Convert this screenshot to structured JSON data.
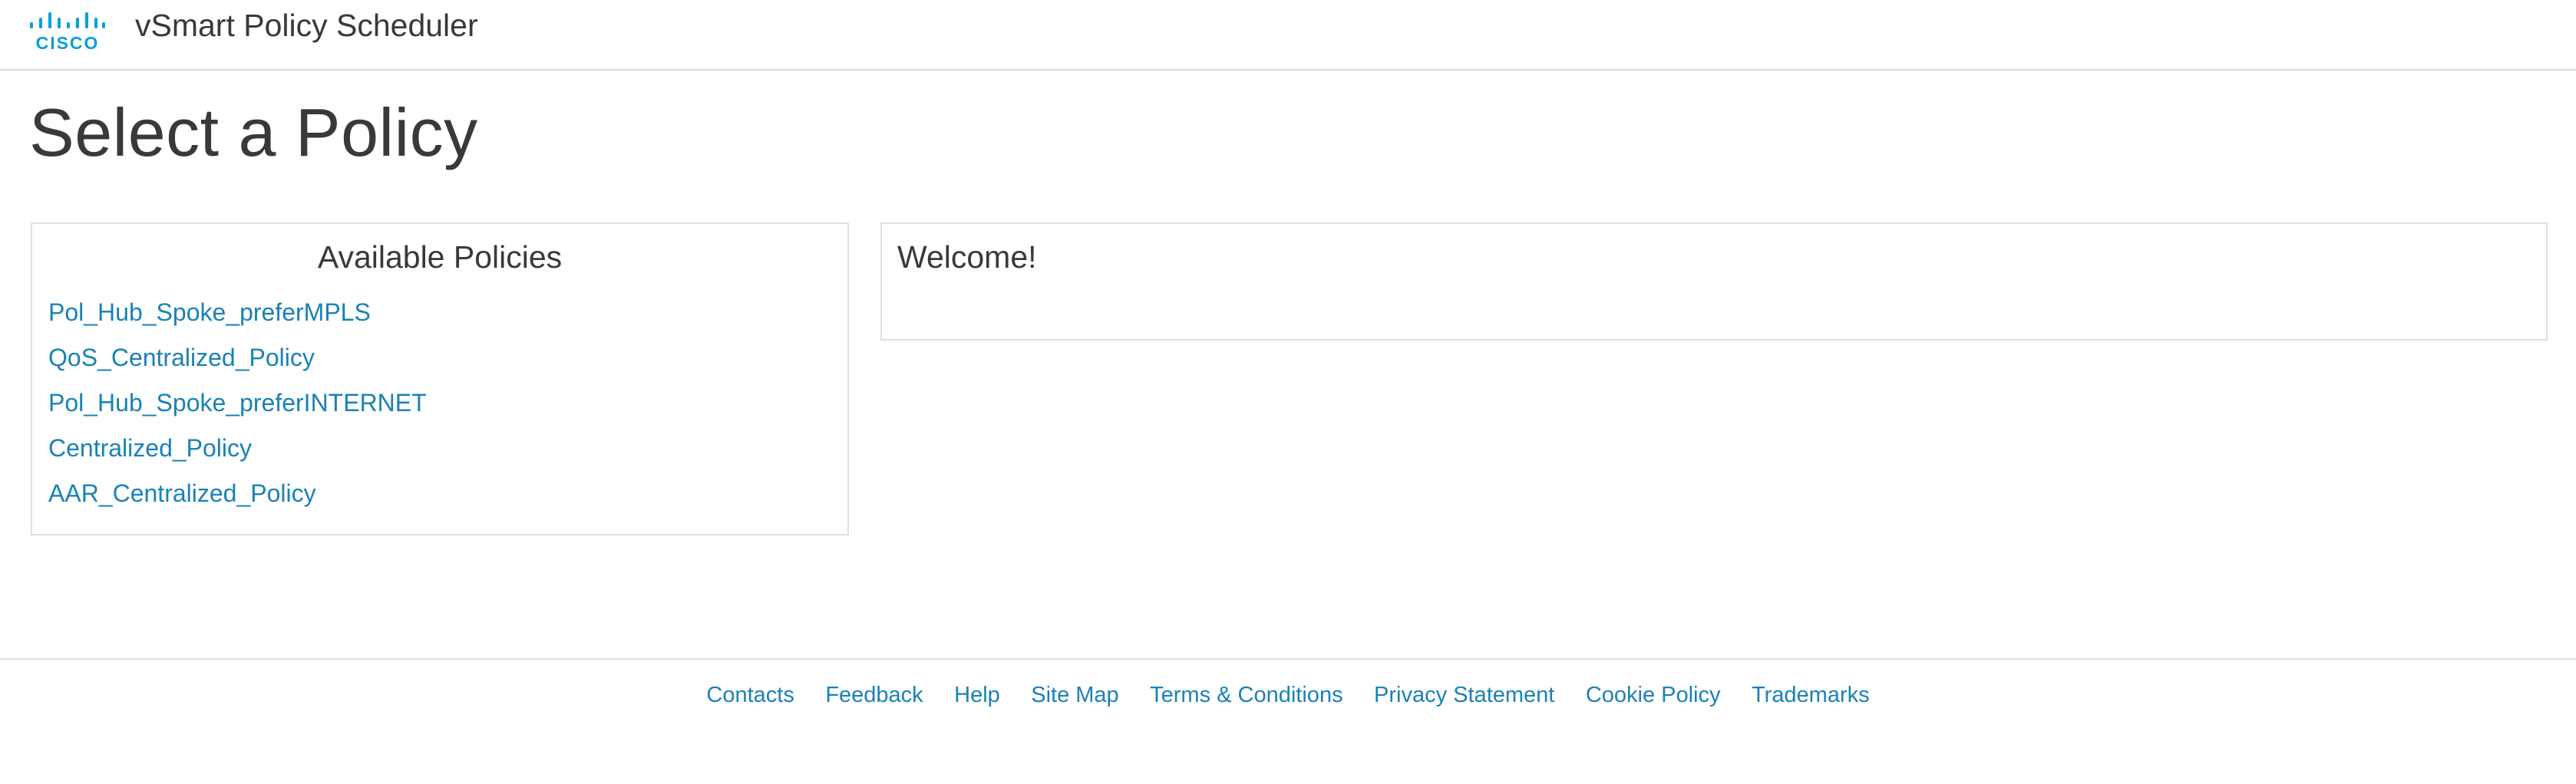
{
  "header": {
    "logo_text": "CISCO",
    "logo_icon": "cisco-logo-icon",
    "app_title": "vSmart Policy Scheduler"
  },
  "page": {
    "title": "Select a Policy"
  },
  "policies_panel": {
    "heading": "Available Policies",
    "items": [
      {
        "label": "Pol_Hub_Spoke_preferMPLS"
      },
      {
        "label": "QoS_Centralized_Policy"
      },
      {
        "label": "Pol_Hub_Spoke_preferINTERNET"
      },
      {
        "label": "Centralized_Policy"
      },
      {
        "label": "AAR_Centralized_Policy"
      }
    ]
  },
  "welcome_panel": {
    "text": "Welcome!"
  },
  "footer": {
    "links": [
      {
        "label": "Contacts"
      },
      {
        "label": "Feedback"
      },
      {
        "label": "Help"
      },
      {
        "label": "Site Map"
      },
      {
        "label": "Terms & Conditions"
      },
      {
        "label": "Privacy Statement"
      },
      {
        "label": "Cookie Policy"
      },
      {
        "label": "Trademarks"
      }
    ]
  },
  "colors": {
    "link": "#1a82b5",
    "brand": "#049fd9",
    "text": "#39393b",
    "border": "#dfdfdf"
  }
}
